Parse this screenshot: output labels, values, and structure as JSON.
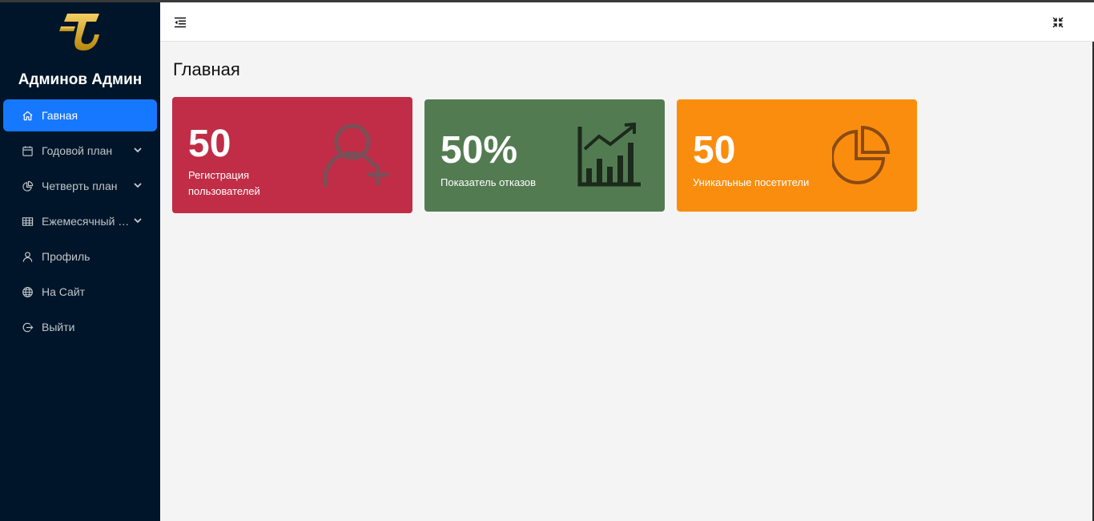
{
  "sidebar": {
    "username": "Админов Админ",
    "items": [
      {
        "label": "Гавная",
        "icon": "home-icon",
        "active": true
      },
      {
        "label": "Годовой план",
        "icon": "calendar-icon",
        "has_children": true
      },
      {
        "label": "Четверть план",
        "icon": "pie-chart-icon",
        "has_children": true
      },
      {
        "label": "Ежемесячный план",
        "icon": "table-icon",
        "has_children": true
      },
      {
        "label": "Профиль",
        "icon": "user-icon"
      },
      {
        "label": "На Сайт",
        "icon": "globe-icon"
      },
      {
        "label": "Выйти",
        "icon": "logout-icon"
      }
    ]
  },
  "header": {
    "menu_toggle_icon": "menu-fold-icon",
    "fullscreen_icon": "fullscreen-icon"
  },
  "main": {
    "title": "Главная",
    "cards": [
      {
        "value": "50",
        "label": "Регистрация пользователей",
        "color": "#c12d46",
        "icon": "user-add-icon"
      },
      {
        "value": "50%",
        "label": "Показатель отказов",
        "color": "#537b52",
        "icon": "bar-chart-rising-icon"
      },
      {
        "value": "50",
        "label": "Уникальные посетители",
        "color": "#fb8d0e",
        "icon": "pie-chart-icon"
      }
    ]
  },
  "colors": {
    "sidebar_bg": "#001529",
    "active_item": "#1677ff",
    "page_bg": "#f4f4f4"
  }
}
